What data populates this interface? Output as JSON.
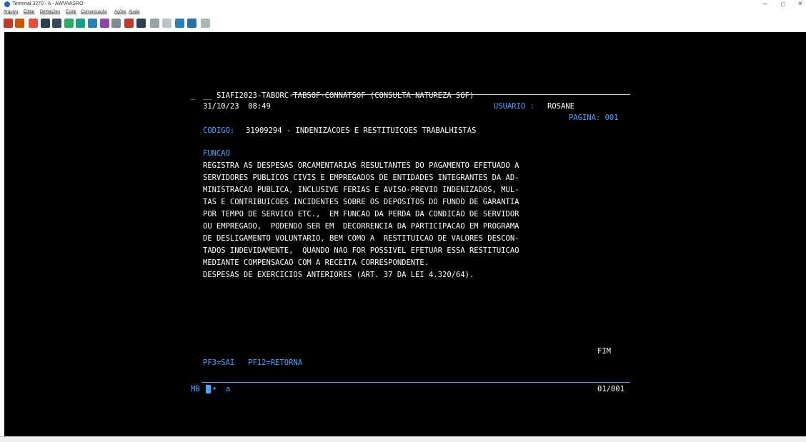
{
  "window": {
    "title": "Terminal 3270 - A - AWVAASRO",
    "minimize": "–",
    "maximize": "\u0001",
    "close": "×"
  },
  "menu": [
    "Arquivo",
    "Editar",
    "Definições",
    "Exibir",
    "Comunicação",
    "Ações",
    "Ajuda"
  ],
  "toolbar": {
    "icons": [
      "copy-icon",
      "paste-icon",
      "exit-icon",
      "print-icon",
      "print-screen-icon",
      "send-icon",
      "receive-icon",
      "transfer-icon",
      "keyboard-icon",
      "macro-icon",
      "record-icon",
      "play-icon",
      "pause-icon",
      "stop-icon",
      "link-icon",
      "upload-icon",
      "refresh-icon"
    ],
    "colors": [
      "#c0392b",
      "#d35400",
      "#e74c3c",
      "#2c3e50",
      "#34495e",
      "#27ae60",
      "#16a085",
      "#2980b9",
      "#8e44ad",
      "#7f8c8d",
      "#c0392b",
      "#2c3e50",
      "#95a5a6",
      "#bdc3c7",
      "#2980b9",
      "#2471a3",
      "#aab7b8"
    ]
  },
  "terminal": {
    "marker": "_",
    "header": "__ SIAFI2023-TABORC-TABSOF-CONNATSOF (CONSULTA NATUREZA SOF)",
    "date_time": "31/10/23  08:49",
    "usuario_label": "USUARIO :",
    "usuario_value": "ROSANE",
    "pagina": "PAGINA: 001",
    "codigo_label": "CODIGO:",
    "codigo_value": "31909294 - INDENIZACOES E RESTITUICOES TRABALHISTAS",
    "funcao_label": "FUNCAO",
    "body_lines": [
      "REGISTRA AS DESPESAS ORCAMENTARIAS RESULTANTES DO PAGAMENTO EFETUADO A",
      "SERVIDORES PUBLICOS CIVIS E EMPREGADOS DE ENTIDADES INTEGRANTES DA AD-",
      "MINISTRACAO PUBLICA, INCLUSIVE FERIAS E AVISO-PREVIO INDENIZADOS, MUL-",
      "TAS E CONTRIBUICOES INCIDENTES SOBRE OS DEPOSITOS DO FUNDO DE GARANTIA",
      "POR TEMPO DE SERVICO ETC.,  EM FUNCAO DA PERDA DA CONDICAO DE SERVIDOR",
      "OU EMPREGADO,  PODENDO SER EM  DECORRENCIA DA PARTICIPACAO EM PROGRAMA",
      "DE DESLIGAMENTO VOLUNTARIO, BEM COMO A  RESTITUICAO DE VALORES DESCON-",
      "TADOS INDEVIDAMENTE,  QUANDO NAO FOR POSSIVEL EFETUAR ESSA RESTITUICAO",
      "MEDIANTE COMPENSACAO COM A RECEITA CORRESPONDENTE.",
      "DESPESAS DE EXERCICIOS ANTERIORES (ART. 37 DA LEI 4.320/64)."
    ],
    "fim": "FIM",
    "pf_keys": "PF3=SAI   PF12=RETORNA",
    "oia_left": "MB",
    "oia_dot": "•",
    "oia_input": "a",
    "oia_pos": "01/001",
    "colors": {
      "background": "#000000",
      "text": "#ffffff",
      "accent": "#4aa3ff"
    }
  }
}
